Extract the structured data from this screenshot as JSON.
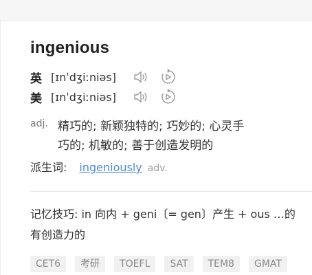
{
  "entry": {
    "word": "ingenious",
    "pronunciations": [
      {
        "label": "英",
        "ipa": "[ɪnˈdʒiːniəs]"
      },
      {
        "label": "美",
        "ipa": "[ɪnˈdʒiːniəs]"
      }
    ],
    "definition": {
      "pos": "adj.",
      "line1": "精巧的;  新颖独特的;  巧妙的;  心灵手",
      "line2": "巧的;  机敏的;  善于创造发明的"
    },
    "derivative": {
      "label": "派生词:",
      "word": "ingeniously",
      "pos": "adv."
    },
    "mnemonic": {
      "line1": "记忆技巧: in 向内 + geni〔= gen〕产生 + ous …的",
      "line2": "有创造力的"
    },
    "tags": [
      "CET6",
      "考研",
      "TOEFL",
      "SAT",
      "TEM8",
      "GMAT"
    ]
  },
  "icons": {
    "speaker": "speaker-icon",
    "replay": "replay-icon"
  },
  "colors": {
    "link": "#4a8bd6",
    "tag_bg": "#f1f1f1"
  }
}
